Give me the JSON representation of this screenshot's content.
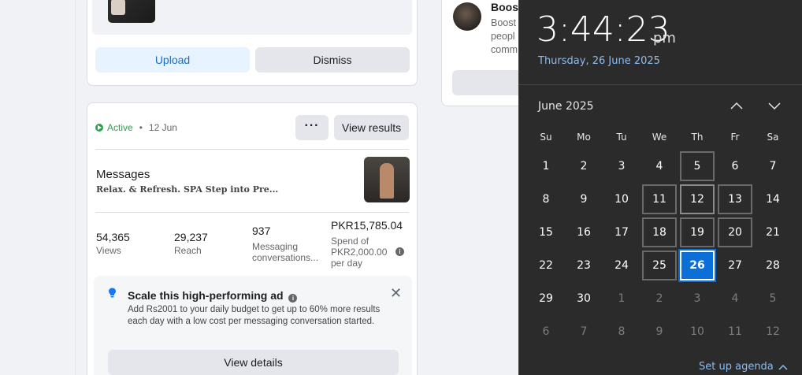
{
  "upload_card": {
    "upload_label": "Upload",
    "dismiss_label": "Dismiss"
  },
  "right_card": {
    "title": "Boos",
    "desc_lines": [
      "Boost",
      "peopl",
      "comm"
    ]
  },
  "ad_card": {
    "status": "Active",
    "date": "12 Jun",
    "more_label": "···",
    "view_results_label": "View results",
    "title": "Messages",
    "subtitle": "𝐑𝐞𝐥𝐚𝐱. & 𝐑𝐞𝐟𝐫𝐞𝐬𝐡. SPA Step into Pre...",
    "stats": {
      "views": {
        "value": "54,365",
        "label": "Views"
      },
      "reach": {
        "value": "29,237",
        "label": "Reach"
      },
      "messaging": {
        "value": "937",
        "label_line1": "Messaging",
        "label_line2": "conversations..."
      },
      "spend": {
        "value": "PKR15,785.04",
        "label_line1": "Spend of",
        "label_line2": "PKR2,000.00",
        "label_line3": "per day"
      }
    },
    "scale": {
      "title": "Scale this high-performing ad",
      "desc": "Add Rs2001 to your daily budget to get up to 60% more results each day with a low cost per messaging conversation started.",
      "view_details_label": "View details",
      "close_label": "✕"
    }
  },
  "clock": {
    "time": "3:44:23",
    "ampm": "pm",
    "date": "Thursday, 26 June 2025",
    "month": "June 2025",
    "weekdays": [
      "Su",
      "Mo",
      "Tu",
      "We",
      "Th",
      "Fr",
      "Sa"
    ],
    "weeks": [
      [
        "1",
        "2",
        "3",
        "4",
        "5",
        "6",
        "7"
      ],
      [
        "8",
        "9",
        "10",
        "11",
        "12",
        "13",
        "14"
      ],
      [
        "15",
        "16",
        "17",
        "18",
        "19",
        "20",
        "21"
      ],
      [
        "22",
        "23",
        "24",
        "25",
        "26",
        "27",
        "28"
      ],
      [
        "29",
        "30",
        "1",
        "2",
        "3",
        "4",
        "5"
      ],
      [
        "6",
        "7",
        "8",
        "9",
        "10",
        "11",
        "12"
      ]
    ],
    "today": "26",
    "agenda_label": "Set up agenda",
    "accent_color": "#0a6fd6",
    "link_color": "#8fbcf0"
  }
}
